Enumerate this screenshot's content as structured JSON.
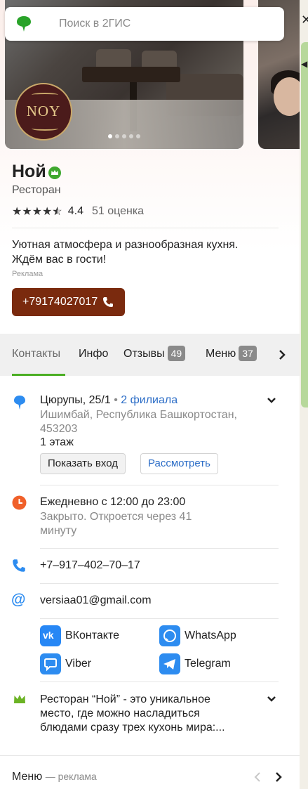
{
  "search": {
    "placeholder": "Поиск в 2ГИС"
  },
  "photo": {
    "logo_text": "NOY",
    "dots_count": 5,
    "active_dot": 0
  },
  "place": {
    "name": "Ной",
    "category": "Ресторан",
    "rating": "4.4",
    "rating_stars": 4.5,
    "reviews_count": "51 оценка"
  },
  "promo": {
    "text": "Уютная атмосфера и разнообразная кухня. Ждём вас в гости!",
    "ad_label": "Реклама",
    "phone_button": "+79174027017"
  },
  "tabs": [
    {
      "label": "Контакты",
      "active": true
    },
    {
      "label": "Инфо"
    },
    {
      "label": "Отзывы",
      "badge": "49"
    },
    {
      "label": "Меню",
      "badge": "37"
    }
  ],
  "address": {
    "street": "Цюрупы, 25/1",
    "branches": "2 филиала",
    "city": "Ишимбай, Республика Башкортостан, 453203",
    "floor": "1 этаж",
    "show_entrance": "Показать вход",
    "view": "Рассмотреть"
  },
  "hours": {
    "schedule": "Ежедневно с 12:00 до 23:00",
    "status": "Закрыто. Откроется через 41 минуту"
  },
  "phone": "+7‒917‒402‒70‒17",
  "email": "versiaa01@gmail.com",
  "socials": [
    {
      "name": "ВКонтакте",
      "color": "#2787f5",
      "icon": "vk-icon"
    },
    {
      "name": "WhatsApp",
      "color": "#2d8cf0",
      "icon": "whatsapp-icon"
    },
    {
      "name": "Viber",
      "color": "#2d8cf0",
      "icon": "viber-icon"
    },
    {
      "name": "Telegram",
      "color": "#2d8cf0",
      "icon": "telegram-icon"
    }
  ],
  "description": "Ресторан “Ной” - это уникальное место, где можно насладиться блюдами сразу трех кухонь мира:...",
  "menu_footer": {
    "title": "Меню",
    "sub": "— реклама"
  },
  "colors": {
    "accent_green": "#4caf24",
    "brand_button": "#7a2a0e",
    "link": "#2d6ec7"
  }
}
